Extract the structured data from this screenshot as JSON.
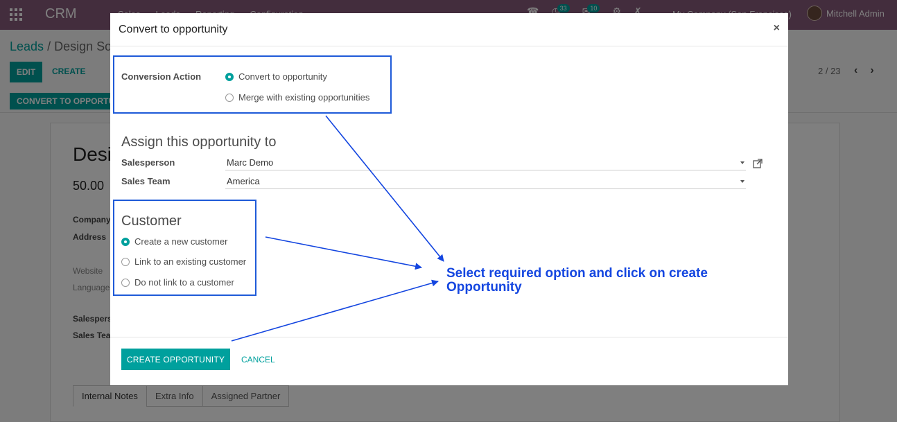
{
  "topbar": {
    "brand": "CRM",
    "menu": [
      "Sales",
      "Leads",
      "Reporting",
      "Configuration"
    ],
    "badges": {
      "activities": "33",
      "messages": "10"
    },
    "company": "My Company (San Francisco)",
    "user": "Mitchell Admin"
  },
  "background": {
    "breadcrumb_root": "Leads",
    "breadcrumb_separator": "/",
    "breadcrumb_current": "Design Software",
    "edit_label": "EDIT",
    "create_label": "CREATE",
    "convert_label": "CONVERT TO OPPORTUNITY",
    "pager": "2 / 23",
    "record_title": "Design Software",
    "record_revenue": "50.00",
    "labels": {
      "company": "Company",
      "address": "Address",
      "website": "Website",
      "language": "Language",
      "salesperson": "Salesperson",
      "sales_team": "Sales Team"
    },
    "tabs": [
      "Internal Notes",
      "Extra Info",
      "Assigned Partner"
    ]
  },
  "modal": {
    "title": "Convert to opportunity",
    "close_symbol": "×",
    "conversion_action_label": "Conversion Action",
    "conversion_options": [
      {
        "label": "Convert to opportunity",
        "checked": true
      },
      {
        "label": "Merge with existing opportunities",
        "checked": false
      }
    ],
    "assign_title": "Assign this opportunity to",
    "salesperson_label": "Salesperson",
    "salesperson_value": "Marc Demo",
    "sales_team_label": "Sales Team",
    "sales_team_value": "America",
    "customer_title": "Customer",
    "customer_options": [
      {
        "label": "Create a new customer",
        "checked": true
      },
      {
        "label": "Link to an existing customer",
        "checked": false
      },
      {
        "label": "Do not link to a customer",
        "checked": false
      }
    ],
    "create_button_label": "CREATE OPPORTUNITY",
    "cancel_button_label": "CANCEL"
  },
  "annotation": {
    "callout_text": "Select required option and click on create Opportunity",
    "color": "#1446e0"
  },
  "colors": {
    "topbar": "#875a7b",
    "primary": "#00a09d",
    "highlight_border": "#1e5ad8"
  }
}
